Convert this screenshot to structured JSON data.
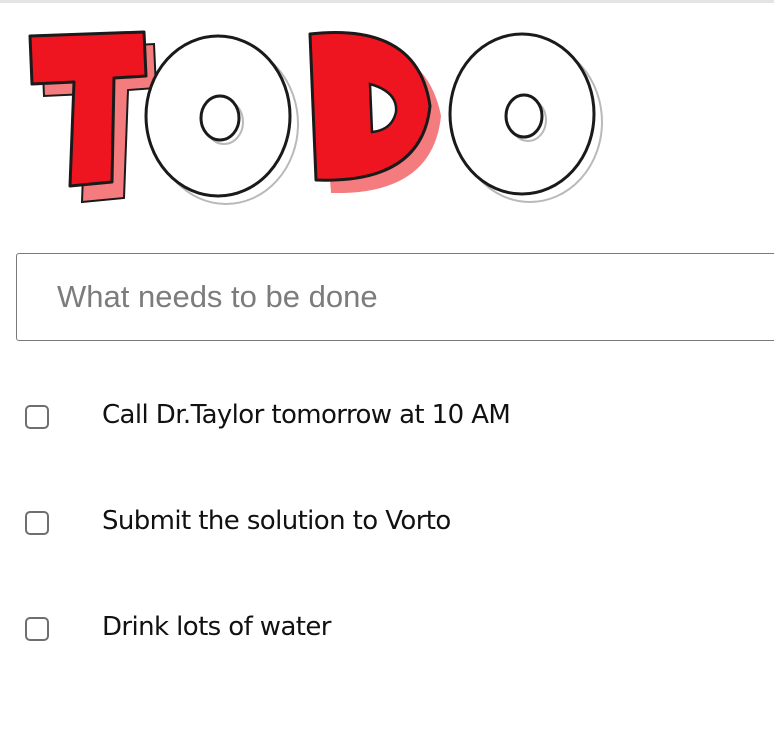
{
  "logo": {
    "text": "TODO",
    "letters": [
      "T",
      "O",
      "D",
      "O"
    ],
    "colors": {
      "red": "#ee1520",
      "red_shadow": "#f47c7f",
      "outline": "#1a1a1a",
      "white": "#ffffff",
      "grey_shadow": "#d4d4d4"
    }
  },
  "input": {
    "placeholder": "What needs to be done",
    "value": ""
  },
  "todos": [
    {
      "text": "Call Dr.Taylor tomorrow at 10 AM",
      "completed": false
    },
    {
      "text": "Submit the solution to Vorto",
      "completed": false
    },
    {
      "text": "Drink lots of water",
      "completed": false
    }
  ]
}
